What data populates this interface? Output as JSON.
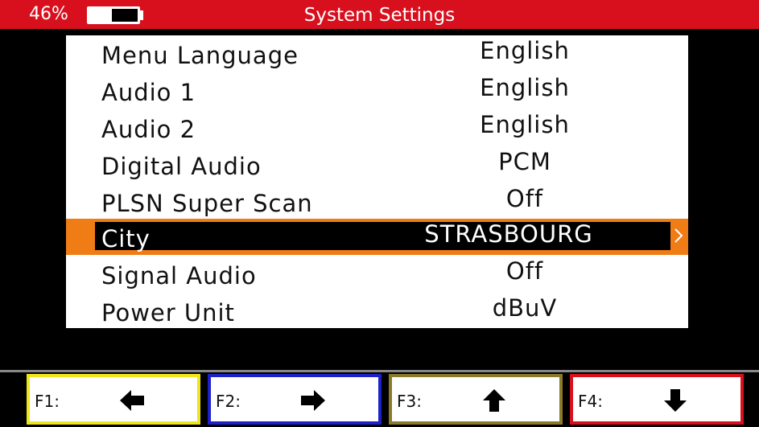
{
  "status": {
    "battery_text": "46%",
    "battery_level": 0.46
  },
  "header": {
    "title": "System Settings"
  },
  "settings": [
    {
      "label": "Menu Language",
      "value": "English",
      "selected": false
    },
    {
      "label": "Audio 1",
      "value": "English",
      "selected": false
    },
    {
      "label": "Audio 2",
      "value": "English",
      "selected": false
    },
    {
      "label": "Digital Audio",
      "value": "PCM",
      "selected": false
    },
    {
      "label": "PLSN Super Scan",
      "value": "Off",
      "selected": false
    },
    {
      "label": "City",
      "value": "STRASBOURG",
      "selected": true
    },
    {
      "label": "Signal Audio",
      "value": "Off",
      "selected": false
    },
    {
      "label": "Power Unit",
      "value": "dBuV",
      "selected": false
    }
  ],
  "function_keys": [
    {
      "label": "F1:",
      "icon": "arrow-left-icon",
      "color": "#f1e41c"
    },
    {
      "label": "F2:",
      "icon": "arrow-right-icon",
      "color": "#1c22c8"
    },
    {
      "label": "F3:",
      "icon": "arrow-up-icon",
      "color": "#8a7a2a"
    },
    {
      "label": "F4:",
      "icon": "arrow-down-icon",
      "color": "#d8101e"
    }
  ],
  "colors": {
    "header": "#d8101e",
    "highlight": "#f07c16"
  }
}
